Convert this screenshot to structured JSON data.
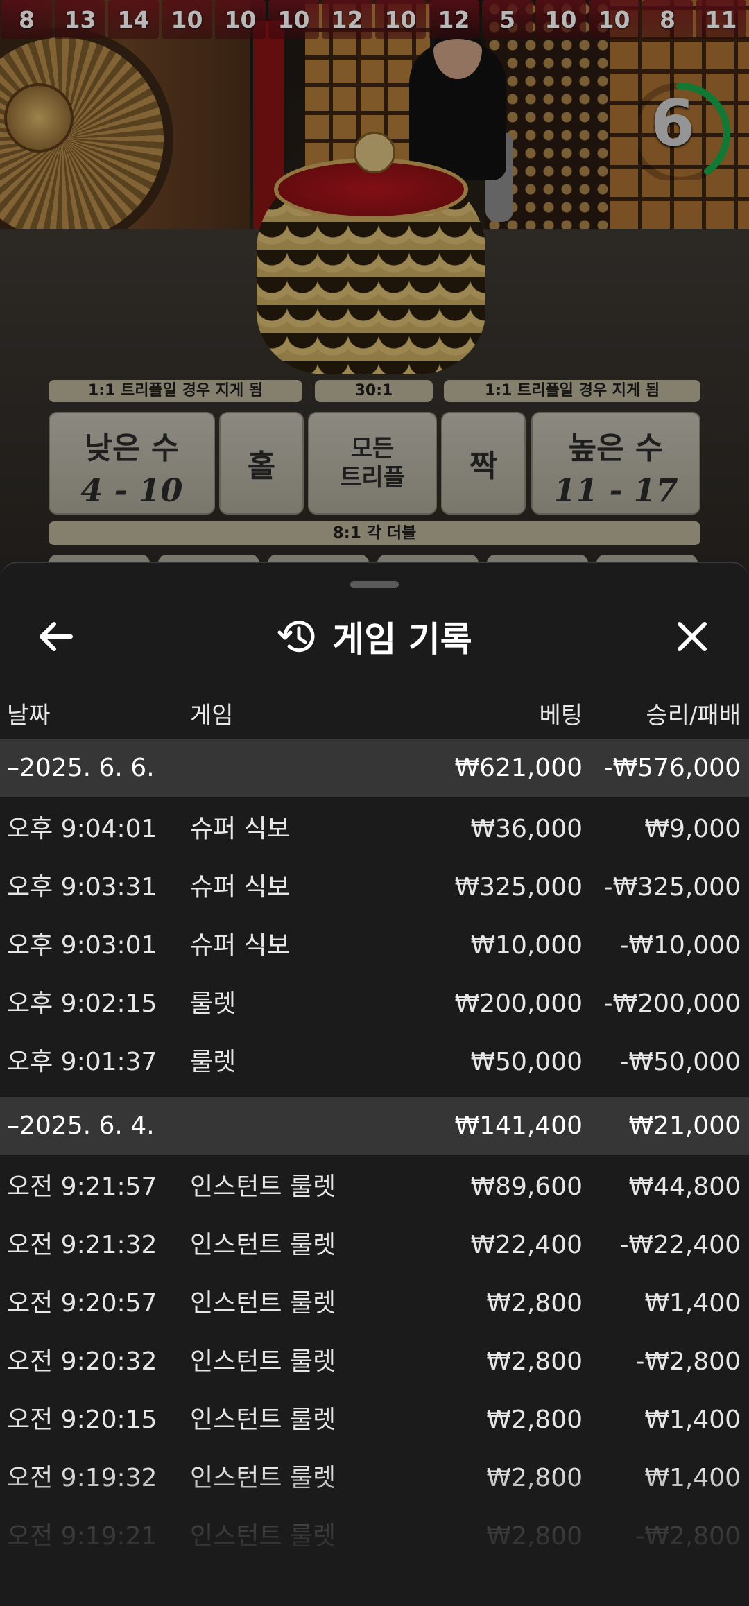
{
  "results_strip": [
    "8",
    "13",
    "14",
    "10",
    "10",
    "10",
    "12",
    "10",
    "12",
    "5",
    "10",
    "10",
    "8",
    "11"
  ],
  "timer": {
    "value": "6",
    "ring_color": "#19a84a",
    "remaining_fraction": 0.4
  },
  "board": {
    "payout_low": "1:1 트리플일 경우 지게 됨",
    "payout_triple": "30:1",
    "payout_high": "1:1 트리플일 경우 지게 됨",
    "low_label": "낮은 수",
    "low_range": "4 - 10",
    "odd_label": "홀",
    "any_triple_line1": "모든",
    "any_triple_line2": "트리플",
    "even_label": "짝",
    "high_label": "높은 수",
    "high_range": "11 - 17",
    "double_payout": "8:1 각 더블"
  },
  "sheet": {
    "title": "게임 기록",
    "icons": {
      "back": "arrow-left-icon",
      "history": "history-icon",
      "close": "close-icon"
    },
    "columns": {
      "date": "날짜",
      "game": "게임",
      "bet": "베팅",
      "result": "승리/패배"
    },
    "groups": [
      {
        "date": "–2025. 6. 6.",
        "total_bet": "₩621,000",
        "total_result": "-₩576,000",
        "rows": [
          {
            "time": "오후 9:04:01",
            "game": "슈퍼 식보",
            "bet": "₩36,000",
            "result": "₩9,000"
          },
          {
            "time": "오후 9:03:31",
            "game": "슈퍼 식보",
            "bet": "₩325,000",
            "result": "-₩325,000"
          },
          {
            "time": "오후 9:03:01",
            "game": "슈퍼 식보",
            "bet": "₩10,000",
            "result": "-₩10,000"
          },
          {
            "time": "오후 9:02:15",
            "game": "룰렛",
            "bet": "₩200,000",
            "result": "-₩200,000"
          },
          {
            "time": "오후 9:01:37",
            "game": "룰렛",
            "bet": "₩50,000",
            "result": "-₩50,000"
          }
        ]
      },
      {
        "date": "–2025. 6. 4.",
        "total_bet": "₩141,400",
        "total_result": "₩21,000",
        "rows": [
          {
            "time": "오전 9:21:57",
            "game": "인스턴트 룰렛",
            "bet": "₩89,600",
            "result": "₩44,800"
          },
          {
            "time": "오전 9:21:32",
            "game": "인스턴트 룰렛",
            "bet": "₩22,400",
            "result": "-₩22,400"
          },
          {
            "time": "오전 9:20:57",
            "game": "인스턴트 룰렛",
            "bet": "₩2,800",
            "result": "₩1,400"
          },
          {
            "time": "오전 9:20:32",
            "game": "인스턴트 룰렛",
            "bet": "₩2,800",
            "result": "-₩2,800"
          },
          {
            "time": "오전 9:20:15",
            "game": "인스턴트 룰렛",
            "bet": "₩2,800",
            "result": "₩1,400"
          },
          {
            "time": "오전 9:19:32",
            "game": "인스턴트 룰렛",
            "bet": "₩2,800",
            "result": "₩1,400"
          },
          {
            "time": "오전 9:19:21",
            "game": "인스턴트 룰렛",
            "bet": "₩2,800",
            "result": "-₩2,800"
          }
        ]
      }
    ]
  }
}
